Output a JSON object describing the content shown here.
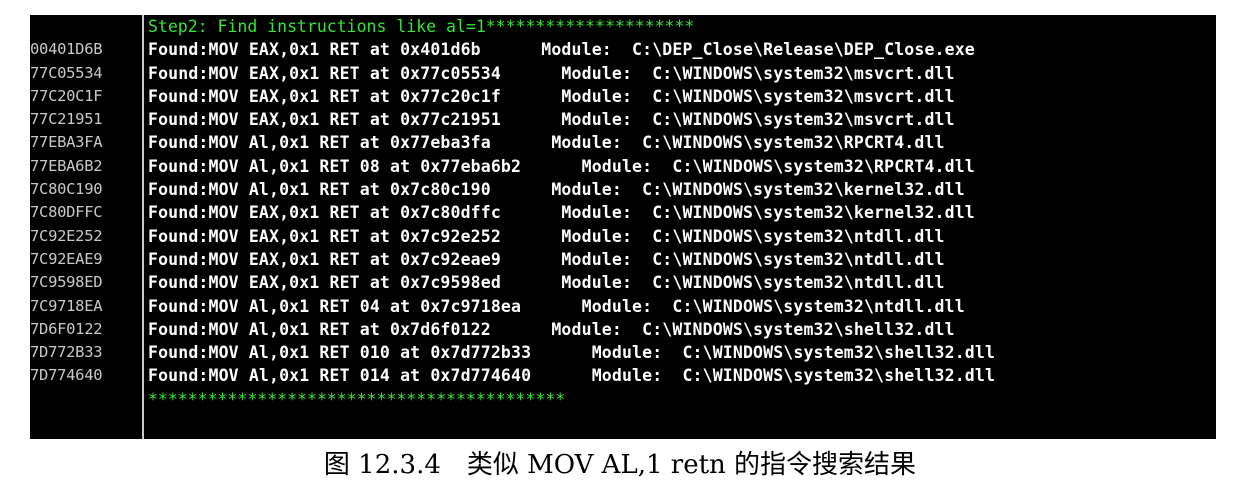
{
  "console": {
    "top_stars": "******************************************",
    "step_title": "Step2: Find instructions like al=1*********************",
    "bottom_stars": "******************************************",
    "rows": [
      {
        "addr": "00401D6B",
        "text": "Found:MOV EAX,0x1 RET at 0x401d6b      Module:  C:\\DEP_Close\\Release\\DEP_Close.exe"
      },
      {
        "addr": "77C05534",
        "text": "Found:MOV EAX,0x1 RET at 0x77c05534      Module:  C:\\WINDOWS\\system32\\msvcrt.dll"
      },
      {
        "addr": "77C20C1F",
        "text": "Found:MOV EAX,0x1 RET at 0x77c20c1f      Module:  C:\\WINDOWS\\system32\\msvcrt.dll"
      },
      {
        "addr": "77C21951",
        "text": "Found:MOV EAX,0x1 RET at 0x77c21951      Module:  C:\\WINDOWS\\system32\\msvcrt.dll"
      },
      {
        "addr": "77EBA3FA",
        "text": "Found:MOV Al,0x1 RET at 0x77eba3fa      Module:  C:\\WINDOWS\\system32\\RPCRT4.dll"
      },
      {
        "addr": "77EBA6B2",
        "text": "Found:MOV Al,0x1 RET 08 at 0x77eba6b2      Module:  C:\\WINDOWS\\system32\\RPCRT4.dll"
      },
      {
        "addr": "7C80C190",
        "text": "Found:MOV Al,0x1 RET at 0x7c80c190      Module:  C:\\WINDOWS\\system32\\kernel32.dll"
      },
      {
        "addr": "7C80DFFC",
        "text": "Found:MOV EAX,0x1 RET at 0x7c80dffc      Module:  C:\\WINDOWS\\system32\\kernel32.dll"
      },
      {
        "addr": "7C92E252",
        "text": "Found:MOV EAX,0x1 RET at 0x7c92e252      Module:  C:\\WINDOWS\\system32\\ntdll.dll"
      },
      {
        "addr": "7C92EAE9",
        "text": "Found:MOV EAX,0x1 RET at 0x7c92eae9      Module:  C:\\WINDOWS\\system32\\ntdll.dll"
      },
      {
        "addr": "7C9598ED",
        "text": "Found:MOV EAX,0x1 RET at 0x7c9598ed      Module:  C:\\WINDOWS\\system32\\ntdll.dll"
      },
      {
        "addr": "7C9718EA",
        "text": "Found:MOV Al,0x1 RET 04 at 0x7c9718ea      Module:  C:\\WINDOWS\\system32\\ntdll.dll"
      },
      {
        "addr": "7D6F0122",
        "text": "Found:MOV Al,0x1 RET at 0x7d6f0122      Module:  C:\\WINDOWS\\system32\\shell32.dll"
      },
      {
        "addr": "7D772B33",
        "text": "Found:MOV Al,0x1 RET 010 at 0x7d772b33      Module:  C:\\WINDOWS\\system32\\shell32.dll"
      },
      {
        "addr": "7D774640",
        "text": "Found:MOV Al,0x1 RET 014 at 0x7d774640      Module:  C:\\WINDOWS\\system32\\shell32.dll"
      }
    ]
  },
  "caption": "图 12.3.4　类似 MOV AL,1 retn 的指令搜索结果"
}
